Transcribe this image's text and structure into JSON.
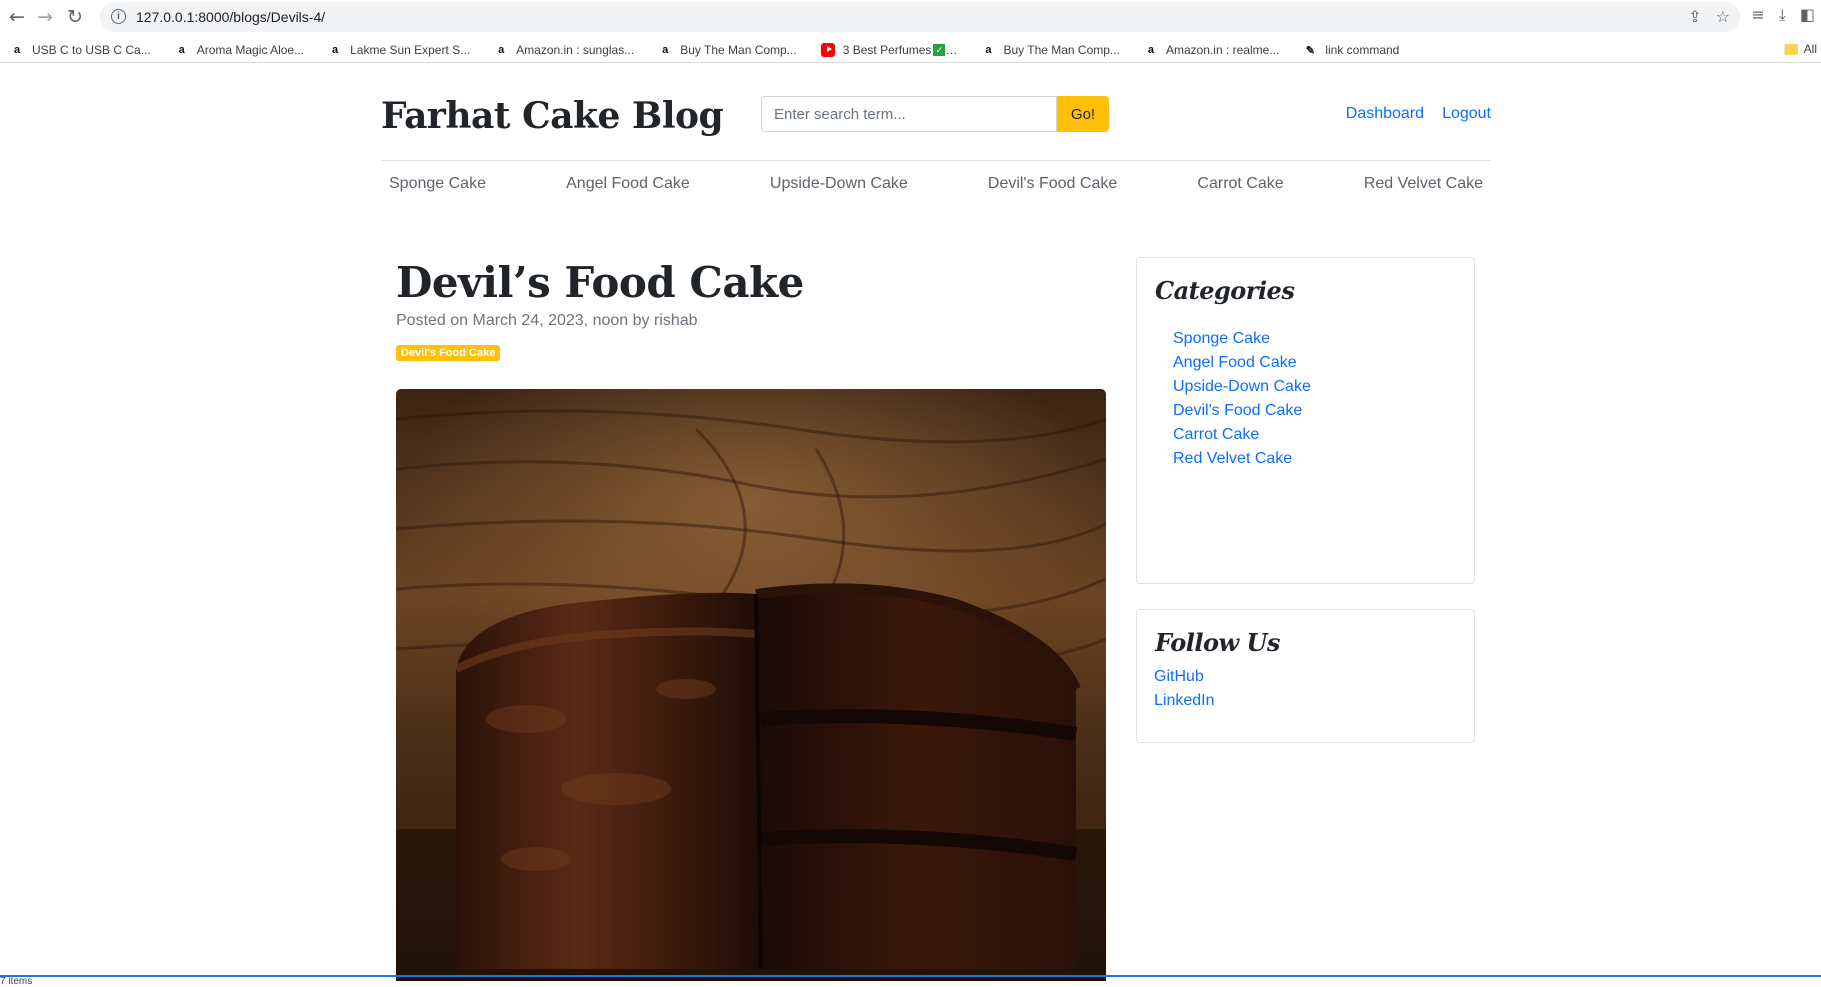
{
  "browser": {
    "url": "127.0.0.1:8000/blogs/Devils-4/",
    "bookmarks": [
      {
        "label": "USB C to USB C Ca...",
        "icon": "amazon-icon"
      },
      {
        "label": "Aroma Magic Aloe...",
        "icon": "amazon-icon"
      },
      {
        "label": "Lakme Sun Expert S...",
        "icon": "amazon-icon"
      },
      {
        "label": "Amazon.in : sunglas...",
        "icon": "amazon-icon"
      },
      {
        "label": "Buy The Man Comp...",
        "icon": "amazon-icon"
      },
      {
        "label": "3 Best Perfumes",
        "icon": "youtube-icon"
      },
      {
        "label": "Buy The Man Comp...",
        "icon": "amazon-icon"
      },
      {
        "label": "Amazon.in : realme...",
        "icon": "amazon-icon"
      },
      {
        "label": "link command",
        "icon": "link-icon"
      }
    ],
    "all_bookmarks_label": "All",
    "status_text": "7 items"
  },
  "site": {
    "title": "Farhat Cake Blog",
    "search_placeholder": "Enter search term...",
    "search_button": "Go!",
    "links": {
      "dashboard": "Dashboard",
      "logout": "Logout"
    },
    "nav": [
      "Sponge Cake",
      "Angel Food Cake",
      "Upside-Down Cake",
      "Devil's Food Cake",
      "Carrot Cake",
      "Red Velvet Cake"
    ]
  },
  "post": {
    "title": "Devil’s Food Cake",
    "meta": "Posted on March 24, 2023, noon by rishab",
    "badge": "Devil's Food Cake"
  },
  "sidebar": {
    "categories_title": "Categories",
    "categories": [
      "Sponge Cake",
      "Angel Food Cake",
      "Upside-Down Cake",
      "Devil's Food Cake",
      "Carrot Cake",
      "Red Velvet Cake"
    ],
    "follow_title": "Follow Us",
    "follow_links": [
      "GitHub",
      "LinkedIn"
    ]
  },
  "colors": {
    "accent": "#ffc107",
    "link": "#0d6efd"
  }
}
